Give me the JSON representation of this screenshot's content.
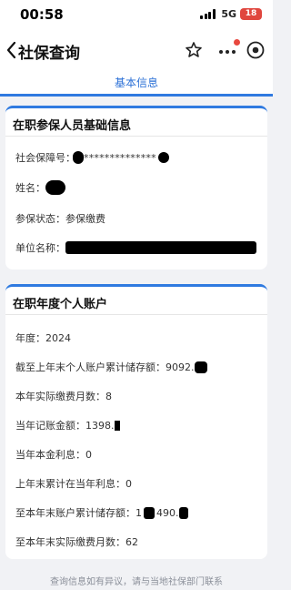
{
  "status_bar": {
    "time": "00:58",
    "network": "5G",
    "battery": "18"
  },
  "nav": {
    "title": "社保查询"
  },
  "tabs": [
    {
      "label": "基本信息"
    }
  ],
  "basic_card": {
    "title": "在职参保人员基础信息",
    "fields": [
      {
        "label": "社会保障号：",
        "value": "**************"
      },
      {
        "label": "姓名：",
        "value": ""
      },
      {
        "label": "参保状态：",
        "value": "参保缴费"
      },
      {
        "label": "单位名称：",
        "value": ""
      }
    ]
  },
  "account_card": {
    "title": "在职年度个人账户",
    "fields": [
      {
        "label": "年度：",
        "value": "2024"
      },
      {
        "label": "截至上年末个人账户累计储存额：",
        "value": "9",
        "value_tail": "092."
      },
      {
        "label": "本年实际缴费月数：",
        "value": "8"
      },
      {
        "label": "当年记账金额：",
        "value": "1",
        "value_tail": "398."
      },
      {
        "label": "当年本金利息：",
        "value": "0"
      },
      {
        "label": "上年末累计在当年利息：",
        "value": "0"
      },
      {
        "label": "至本年末账户累计储存额：",
        "value": "1",
        "value_tail": "490."
      },
      {
        "label": "至本年末实际缴费月数：",
        "value": "62"
      }
    ]
  },
  "footer": {
    "note": "查询信息如有异议，请与当地社保部门联系"
  }
}
